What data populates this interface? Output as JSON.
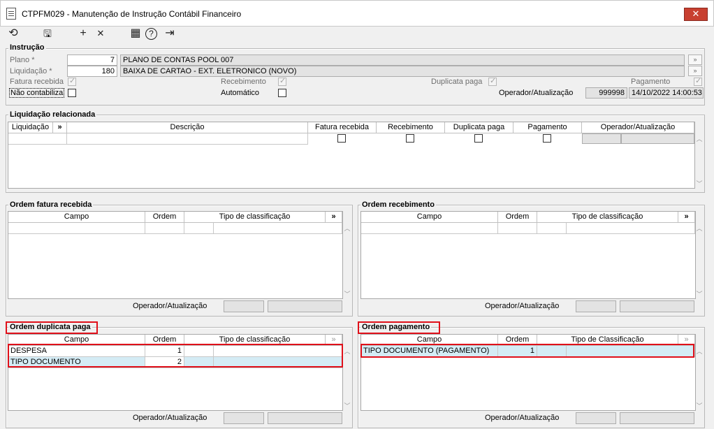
{
  "window": {
    "title": "CTPFM029 - Manutenção de Instrução Contábil Financeiro",
    "close_icon": "✕"
  },
  "toolbar": {
    "refresh": "⟲",
    "save": "🖫",
    "add": "+",
    "delete": "✕",
    "calendar": "▦",
    "help": "?",
    "exit": "⇥"
  },
  "instrucao": {
    "title": "Instrução",
    "plano_label": "Plano *",
    "plano_value": "7",
    "plano_desc": "PLANO DE CONTAS POOL 007",
    "liquidacao_label": "Liquidação *",
    "liquidacao_value": "180",
    "liquidacao_desc": "BAIXA DE CARTAO - EXT. ELETRONICO (NOVO)",
    "fatura_label": "Fatura recebida",
    "recebimento_label": "Recebimento",
    "duplicata_label": "Duplicata paga",
    "pagamento_label": "Pagamento",
    "nao_contabiliza_label": "Não contabiliza",
    "automatico_label": "Automático",
    "operador_label": "Operador/Atualização",
    "operador_value": "999998",
    "atualizacao_value": "14/10/2022 14:00:53",
    "lookup_icon": "»"
  },
  "liquidacao_rel": {
    "title": "Liquidação relacionada",
    "columns": [
      "Liquidação",
      "»",
      "Descrição",
      "Fatura recebida",
      "Recebimento",
      "Duplicata paga",
      "Pagamento",
      "Operador/Atualização"
    ]
  },
  "ordem_fatura": {
    "title": "Ordem fatura recebida",
    "columns": [
      "Campo",
      "Ordem",
      "Tipo de classificação",
      "»"
    ],
    "operador_label": "Operador/Atualização"
  },
  "ordem_recebimento": {
    "title": "Ordem recebimento",
    "columns": [
      "Campo",
      "Ordem",
      "Tipo de classificação",
      "»"
    ],
    "operador_label": "Operador/Atualização"
  },
  "ordem_duplicata": {
    "title": "Ordem duplicata paga",
    "columns": [
      "Campo",
      "Ordem",
      "Tipo de classificação",
      "»"
    ],
    "rows": [
      {
        "campo": "DESPESA",
        "ordem": "1"
      },
      {
        "campo": "TIPO DOCUMENTO",
        "ordem": "2"
      }
    ],
    "operador_label": "Operador/Atualização"
  },
  "ordem_pagamento": {
    "title": "Ordem pagamento",
    "columns": [
      "Campo",
      "Ordem",
      "Tipo de Classificação",
      "»"
    ],
    "rows": [
      {
        "campo": "TIPO DOCUMENTO (PAGAMENTO)",
        "ordem": "1"
      }
    ],
    "operador_label": "Operador/Atualização"
  },
  "colors": {
    "highlight": "#e0101a",
    "selected_row": "#d4ecf5"
  }
}
